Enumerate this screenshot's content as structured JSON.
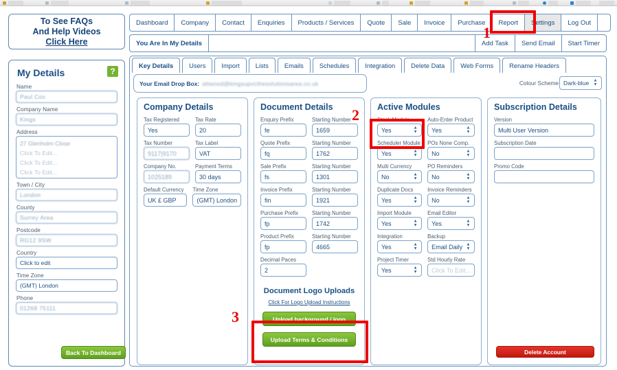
{
  "faq_panel": {
    "line1": "To See FAQs",
    "line2": "And Help Videos",
    "link": "Click Here"
  },
  "my_details": {
    "title": "My Details",
    "help_badge": "?",
    "fields": [
      {
        "label": "Name",
        "value": "Paul Cox",
        "redacted": true
      },
      {
        "label": "Company Name",
        "value": "Kings",
        "redacted": true
      },
      {
        "label": "Address",
        "value": "27 Glenholm Close",
        "redacted": true,
        "extra_lines": [
          "Click To Edit...",
          "Click To Edit...",
          "Click To Edit..."
        ]
      },
      {
        "label": "Town / City",
        "value": "London",
        "redacted": true
      },
      {
        "label": "County",
        "value": "Surrey Area",
        "redacted": true
      },
      {
        "label": "Postcode",
        "value": "RG12 9SW",
        "redacted": true
      },
      {
        "label": "Country",
        "value": "Click to edit",
        "redacted": false
      },
      {
        "label": "Time Zone",
        "value": "(GMT) London",
        "redacted": false
      },
      {
        "label": "Phone",
        "value": "01268 75111",
        "redacted": true
      }
    ],
    "back_button": "Back To Dashboard"
  },
  "main_tabs": [
    {
      "label": "Dashboard",
      "active": false
    },
    {
      "label": "Company",
      "active": false
    },
    {
      "label": "Contact",
      "active": false
    },
    {
      "label": "Enquiries",
      "active": false
    },
    {
      "label": "Products / Services",
      "active": false
    },
    {
      "label": "Quote",
      "active": false
    },
    {
      "label": "Sale",
      "active": false
    },
    {
      "label": "Invoice",
      "active": false
    },
    {
      "label": "Purchase",
      "active": false
    },
    {
      "label": "Report",
      "active": false
    },
    {
      "label": "Settings",
      "active": true
    },
    {
      "label": "Log Out",
      "active": false
    }
  ],
  "sub_bar": {
    "breadcrumb": "You Are In My Details",
    "actions": [
      "Add Task",
      "Send Email",
      "Start Timer"
    ]
  },
  "sub_tabs": [
    {
      "label": "Key Details",
      "active": true
    },
    {
      "label": "Users",
      "active": false
    },
    {
      "label": "Import",
      "active": false
    },
    {
      "label": "Lists",
      "active": false
    },
    {
      "label": "Emails",
      "active": false
    },
    {
      "label": "Schedules",
      "active": false
    },
    {
      "label": "Integration",
      "active": false
    },
    {
      "label": "Delete Data",
      "active": false
    },
    {
      "label": "Web Forms",
      "active": false
    },
    {
      "label": "Rename Headers",
      "active": false
    }
  ],
  "drop_box": {
    "label": "Your Email Drop Box:",
    "value": "attwood@kingsupvcthesolutionsarea.co.uk",
    "redacted": true
  },
  "colour_scheme": {
    "label": "Colour Scheme",
    "value": "Dark-blue"
  },
  "company_details": {
    "title": "Company Details",
    "rows": [
      {
        "left": {
          "label": "Tax Registered",
          "value": "Yes"
        },
        "right": {
          "label": "Tax Rate",
          "value": "20"
        }
      },
      {
        "left": {
          "label": "Tax Number",
          "value": "9117|9170",
          "redacted": true
        },
        "right": {
          "label": "Tax Label",
          "value": "VAT"
        }
      },
      {
        "left": {
          "label": "Company No.",
          "value": "1025189",
          "redacted": true
        },
        "right": {
          "label": "Payment Terms",
          "value": "30 days"
        }
      },
      {
        "left": {
          "label": "Default Currency",
          "value": "UK £ GBP"
        },
        "right": {
          "label": "Time Zone",
          "value": "(GMT) London"
        }
      }
    ]
  },
  "document_details": {
    "title": "Document Details",
    "rows": [
      {
        "left": {
          "label": "Enquiry Prefix",
          "value": "fe"
        },
        "right": {
          "label": "Starting Number",
          "value": "1659"
        }
      },
      {
        "left": {
          "label": "Quote Prefix",
          "value": "fq"
        },
        "right": {
          "label": "Starting Number",
          "value": "1762"
        }
      },
      {
        "left": {
          "label": "Sale Prefix",
          "value": "fs"
        },
        "right": {
          "label": "Starting Number",
          "value": "1301"
        }
      },
      {
        "left": {
          "label": "Invoice Prefix",
          "value": "fin"
        },
        "right": {
          "label": "Starting Number",
          "value": "1921"
        }
      },
      {
        "left": {
          "label": "Purchase Prefix",
          "value": "fp"
        },
        "right": {
          "label": "Starting Number",
          "value": "1742"
        }
      },
      {
        "left": {
          "label": "Product Prefix",
          "value": "fp"
        },
        "right": {
          "label": "Starting Number",
          "value": "4665"
        }
      },
      {
        "left": {
          "label": "Decimal Paces",
          "value": "2"
        },
        "right": null
      }
    ],
    "logo_uploads": {
      "title": "Document Logo Uploads",
      "instructions_link": "Click For Logo Upload Instructions",
      "upload_background_button": "Upload background / logo",
      "upload_terms_button": "Upload Terms & Conditions"
    }
  },
  "active_modules": {
    "title": "Active Modules",
    "left_column": [
      {
        "label": "Stock Module",
        "value": "Yes"
      },
      {
        "label": "Scheduler Module",
        "value": "Yes"
      },
      {
        "label": "Multi Currency",
        "value": "No"
      },
      {
        "label": "Duplicate Docs",
        "value": "Yes"
      },
      {
        "label": "Import Module",
        "value": "Yes"
      },
      {
        "label": "Integration",
        "value": "Yes"
      },
      {
        "label": "Project Timer",
        "value": "Yes"
      }
    ],
    "right_column": [
      {
        "label": "Auto-Enter Product",
        "value": "Yes"
      },
      {
        "label": "POs None Comp.",
        "value": "No"
      },
      {
        "label": "PO Reminders",
        "value": "No"
      },
      {
        "label": "Invoice Reminders",
        "value": "No"
      },
      {
        "label": "Email Editor",
        "value": "Yes"
      },
      {
        "label": "Backup",
        "value": "Email Daily"
      },
      {
        "label": "Std Hourly Rate",
        "value": "Click To Edit...",
        "placeholder": true
      }
    ]
  },
  "subscription_details": {
    "title": "Subscription Details",
    "fields": [
      {
        "label": "Version",
        "value": "Multi User Version"
      },
      {
        "label": "Subscription Date",
        "value": ""
      },
      {
        "label": "Promo Code",
        "value": ""
      }
    ],
    "delete_button": "Delete Account"
  },
  "annotations": [
    {
      "number": "1",
      "target": "settings-tab"
    },
    {
      "number": "2",
      "target": "stock-module-select"
    },
    {
      "number": "3",
      "target": "logo-upload-buttons"
    }
  ],
  "colors": {
    "border_blue": "#6a93bd",
    "text_blue": "#1a4f86",
    "green_button": "#76b234",
    "red_button": "#d11c10",
    "annotation_red": "#f00000"
  }
}
